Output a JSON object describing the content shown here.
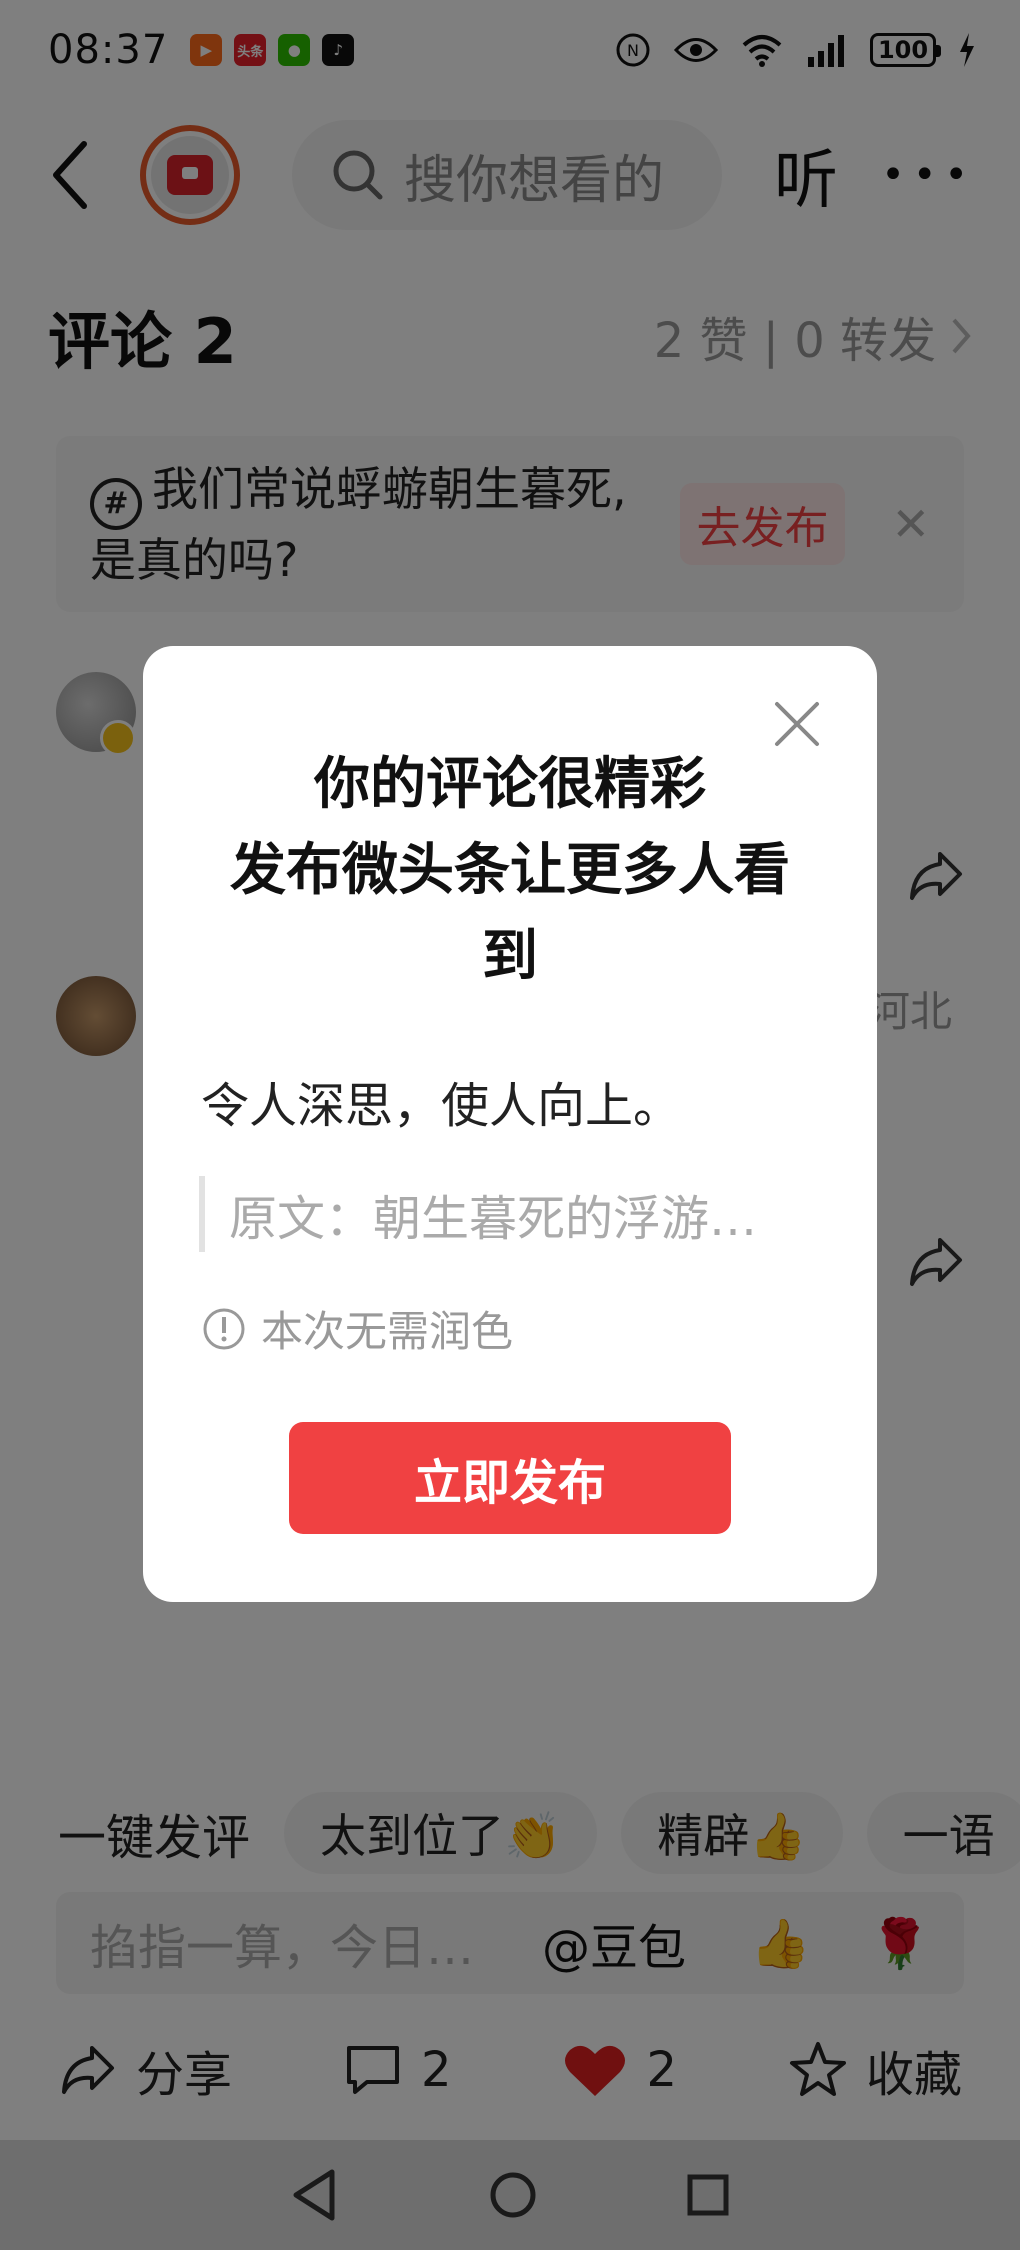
{
  "status_bar": {
    "time": "08:37",
    "apps": [
      "kuaishou-icon",
      "toutiao-icon",
      "wechat-icon",
      "tiktok-icon"
    ],
    "app_texts": [
      "",
      "头条",
      "",
      ""
    ],
    "battery": "100"
  },
  "header": {
    "search_placeholder": "搜你想看的",
    "listen_label": "听"
  },
  "comments": {
    "title": "评论 2",
    "stats": "2 赞 | 0 转发",
    "items": [
      {
        "region": ""
      },
      {
        "region": "河北"
      }
    ]
  },
  "topic": {
    "text": "我们常说蜉蝣朝生暮死,是真的吗?",
    "publish_label": "去发布"
  },
  "dialog": {
    "title_line1": "你的评论很精彩",
    "title_line2": "发布微头条让更多人看到",
    "quote": "令人深思，使人向上。",
    "original": "原文：朝生暮死的浮游…",
    "note": "本次无需润色",
    "publish_button": "立即发布"
  },
  "quick_comments": {
    "label": "一键发评",
    "chips": [
      "太到位了👏",
      "精辟👍",
      "一语"
    ]
  },
  "input": {
    "placeholder": "掐指一算，今日…",
    "mention": "@豆包",
    "emoji1": "👍",
    "emoji2": "🌹"
  },
  "actions": {
    "share": "分享",
    "comment_count": "2",
    "like_count": "2",
    "favorite": "收藏"
  },
  "colors": {
    "accent_red": "#f04142",
    "avatar_ring": "#e85a2a",
    "overlay": "rgba(0,0,0,0.5)"
  }
}
